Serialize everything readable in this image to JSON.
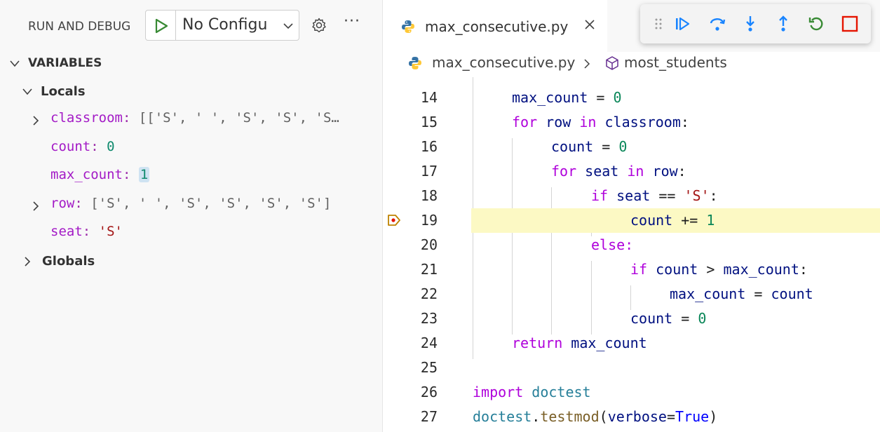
{
  "sidebar": {
    "title": "RUN AND DEBUG",
    "config_label": "No Configu",
    "section_variables": "VARIABLES",
    "group_locals": "Locals",
    "group_globals": "Globals",
    "variables": [
      {
        "name": "classroom",
        "value": "[['S', ' ', 'S', 'S', 'S…",
        "kind": "list",
        "expandable": true
      },
      {
        "name": "count",
        "value": "0",
        "kind": "number",
        "expandable": false
      },
      {
        "name": "max_count",
        "value": "1",
        "kind": "number",
        "expandable": false,
        "changed": true
      },
      {
        "name": "row",
        "value": "['S', ' ', 'S', 'S', 'S', 'S']",
        "kind": "list",
        "expandable": true
      },
      {
        "name": "seat",
        "value": "'S'",
        "kind": "string",
        "expandable": false
      }
    ]
  },
  "editor": {
    "tab_label": "max_consecutive.py",
    "breadcrumb_file": "max_consecutive.py",
    "breadcrumb_symbol": "most_students",
    "current_line": "19",
    "lines": [
      {
        "n": "14"
      },
      {
        "n": "15"
      },
      {
        "n": "16"
      },
      {
        "n": "17"
      },
      {
        "n": "18"
      },
      {
        "n": "19"
      },
      {
        "n": "20"
      },
      {
        "n": "21"
      },
      {
        "n": "22"
      },
      {
        "n": "23"
      },
      {
        "n": "24"
      },
      {
        "n": "25"
      },
      {
        "n": "26"
      },
      {
        "n": "27"
      }
    ],
    "tokens": {
      "max_count": "max_count",
      "count": "count",
      "row": "row",
      "seat": "seat",
      "classroom": "classroom",
      "for": "for",
      "in": "in",
      "if": "if",
      "else": "else:",
      "return": "return",
      "import": "import",
      "doctest": "doctest",
      "testmod": "testmod",
      "verbose": "verbose",
      "true": "True",
      "zero": "0",
      "one": "1",
      "str_s": "'S'"
    }
  },
  "colors": {
    "current_line_bg": "#fcf9c4",
    "debug_accent": "#1a85ff",
    "restart": "#388a34",
    "stop": "#e51400",
    "breakpoint": "#be8200"
  },
  "icons": [
    "play-icon",
    "chevron-down-icon",
    "gear-icon",
    "more-icon",
    "python-icon",
    "close-icon",
    "grip-icon",
    "continue-icon",
    "step-over-icon",
    "step-into-icon",
    "step-out-icon",
    "restart-icon",
    "stop-icon",
    "symbol-method-icon",
    "debug-pointer-icon"
  ]
}
